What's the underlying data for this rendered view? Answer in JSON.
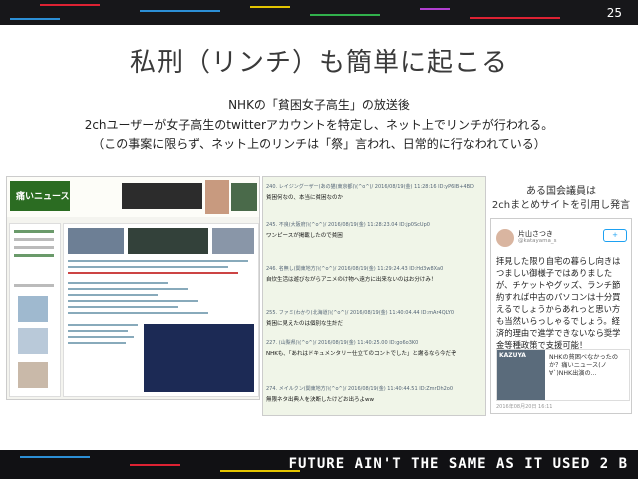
{
  "slide": {
    "page_number": "25",
    "title": "私刑（リンチ）も簡単に起こる",
    "lines": [
      "NHKの「貧困女子高生」の放送後",
      "2chユーザーが女子高生のtwitterアカウントを特定し、ネット上でリンチが行われる。",
      "（この事案に限らず、ネット上のリンチは「祭」言われ、日常的に行なわれている）"
    ],
    "footer": "FUTURE AIN'T THE SAME AS IT USED 2 B"
  },
  "matome": {
    "logo_line1": "痛いニュース",
    "logo_line2": ""
  },
  "thread": {
    "posts": [
      {
        "header": "240. レイジングーザー(あの猫(東京都)\\(^o^)/ 2016/08/19(金) 11:28:16 ID:yP6IB+4BD",
        "body": "貧困何なの、本当に貧困なのか"
      },
      {
        "header": "245. 不良(大阪府)\\(^o^)/ 2016/08/19(金) 11:28:23.04 ID:jp0ScUp0",
        "body": "ワンピースが掲載したので貧困"
      },
      {
        "header": "246. 名無し(関東地方)\\(^o^)/ 2016/08/19(金) 11:29:24.43 ID:Hd3w8Xa0",
        "body": "自炊生活は遊びながらアニメのけ物へ遠方に出来ないのはお分けみ！"
      },
      {
        "header": "255. ファミ(わかり(北海道)\\(^o^)/ 2016/08/19(金) 11:40:04.44 ID:mAr4QLY0",
        "body": "貧困に見えたのは個別な生計だ"
      },
      {
        "header": "227. (山梨県)\\(^o^)/ 2016/08/19(金) 11:40:25.00 ID:go6o3K0",
        "body": "NHKも、「あれはドキュメンタリー仕立てのコントでした」と謝るなら今だぞ"
      },
      {
        "header": "274. メイルクン(関東地方)\\(^o^)/ 2016/08/19(金) 11:40:44.51 ID:ZmrDh2o0",
        "body": "無限ネタ出典人を決断したけどお出ろよww"
      }
    ]
  },
  "politician": {
    "note_line1": "ある国会議員は",
    "note_line2": "2chまとめサイトを引用し発言",
    "name": "片山さつき",
    "handle": "@katayama_s",
    "follow": "+",
    "body": "拝見した限り自宅の暮らし向きはつましい御様子ではありましたが、チケットやグッズ、ランチ節約すれば中古のパソコンは十分買えるでしょうからあれっと思い方も当然いらっしゃるでしょう。経済的理由で進学できないなら奨学金等種政策で支援可能！",
    "card_label": "KAZUYA",
    "card_text": "NHKの貧困ベなかったのか？痛いニュース(ノ∀`)NHK出演の...",
    "date": "2016年08月20日 16:11"
  },
  "colors": {
    "dark_bar": "#17171a",
    "title": "#3a3a3a",
    "accent_blue": "#1da1f2"
  }
}
